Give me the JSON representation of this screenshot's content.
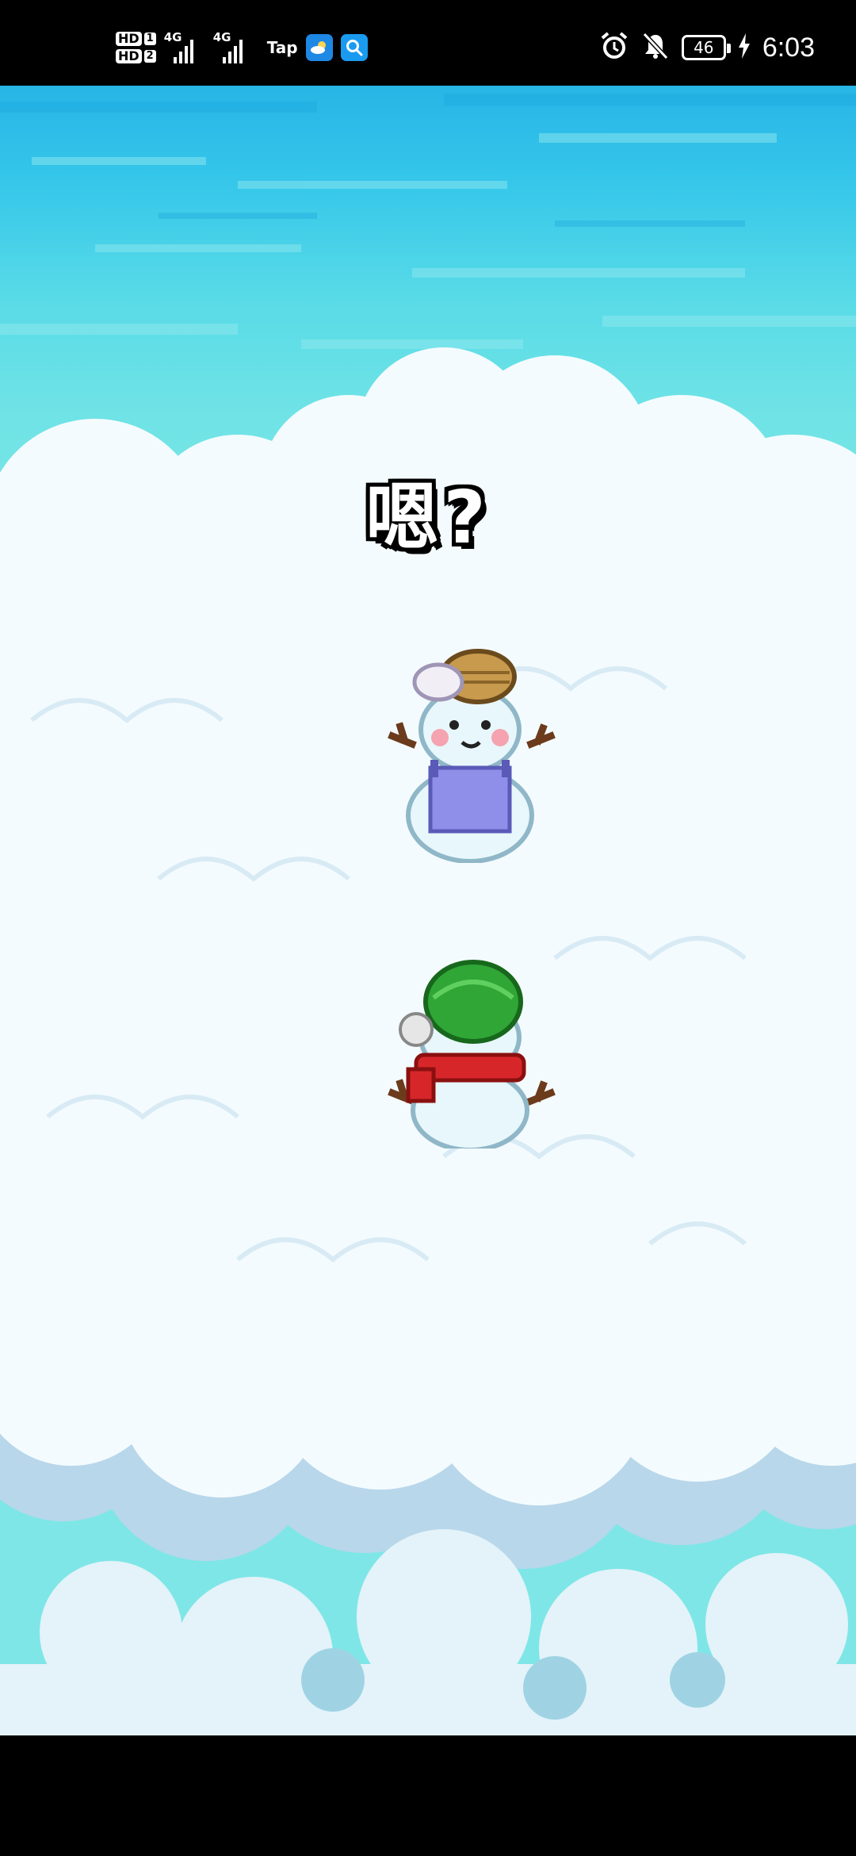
{
  "status_bar": {
    "sim1_label": "HD",
    "sim1_number": "1",
    "sim2_label": "HD",
    "sim2_number": "2",
    "network1": "4G",
    "network2": "4G",
    "tap_label": "Tap",
    "battery_level": "46",
    "time": "6:03",
    "icons": [
      "weather-app-icon",
      "search-app-icon",
      "alarm-icon",
      "mute-icon",
      "charging-icon"
    ]
  },
  "game": {
    "speech_text": "嗯?",
    "characters": [
      {
        "name": "snowman-with-basket-hat-and-apron"
      },
      {
        "name": "snowman-with-green-hat-and-red-scarf"
      }
    ],
    "colors": {
      "sky_top": "#27b5e6",
      "sky_bottom": "#7fe6e7",
      "cloud": "#f4fbfe",
      "cloud_shadow": "#b8d7ea"
    }
  }
}
